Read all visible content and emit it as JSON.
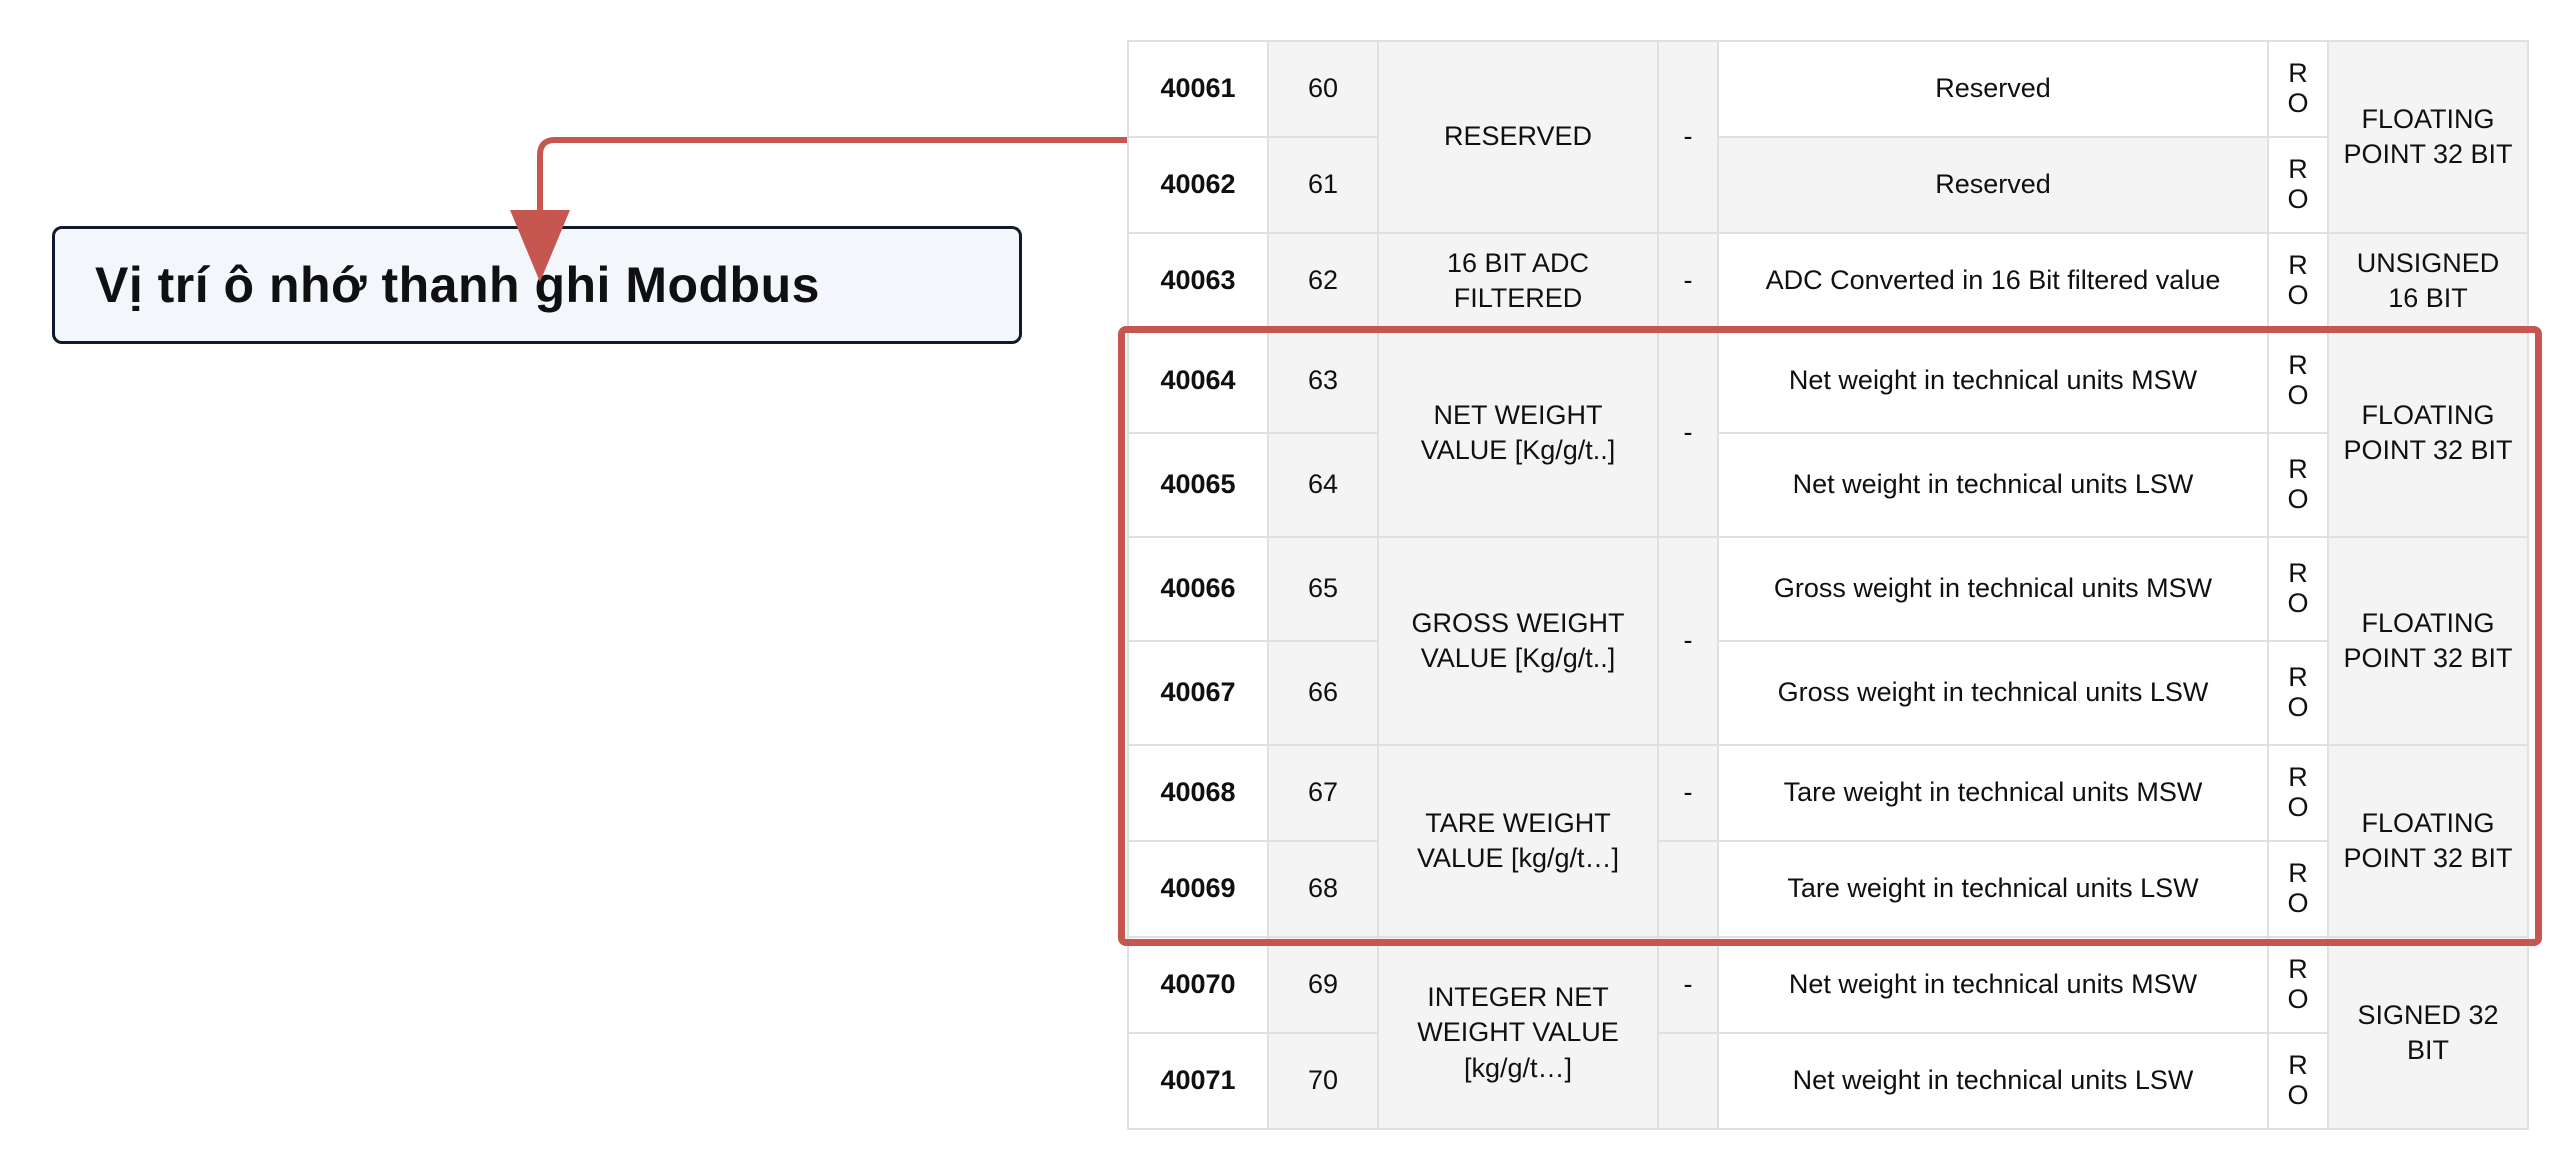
{
  "callout": {
    "label": "Vị trí ô nhớ thanh ghi Modbus"
  },
  "highlight": {
    "color": "#c65750"
  },
  "rows": [
    {
      "addr": "40061",
      "idx": "60",
      "name": "RESERVED",
      "dash": "-",
      "desc": "Reserved",
      "rw1": "R",
      "rw2": "O",
      "type": "FLOATING POINT 32 BIT",
      "alt": false
    },
    {
      "addr": "40062",
      "idx": "61",
      "desc": "Reserved",
      "rw1": "R",
      "rw2": "O",
      "alt": true
    },
    {
      "addr": "40063",
      "idx": "62",
      "name": "16 BIT ADC FILTERED",
      "dash": "-",
      "desc": "ADC Converted in 16 Bit filtered value",
      "rw1": "R",
      "rw2": "O",
      "type": "UNSIGNED 16 BIT",
      "alt": false
    },
    {
      "addr": "40064",
      "idx": "63",
      "name": "NET WEIGHT VALUE [Kg/g/t..]",
      "dash": "-",
      "desc": "Net weight in technical units MSW",
      "rw1": "R",
      "rw2": "O",
      "type": "FLOATING POINT 32 BIT",
      "alt": false
    },
    {
      "addr": "40065",
      "idx": "64",
      "desc": "Net weight in technical units LSW",
      "rw1": "R",
      "rw2": "O",
      "alt": false
    },
    {
      "addr": "40066",
      "idx": "65",
      "name": "GROSS WEIGHT VALUE [Kg/g/t..]",
      "dash": "-",
      "desc": "Gross weight in technical units MSW",
      "rw1": "R",
      "rw2": "O",
      "type": "FLOATING POINT 32 BIT",
      "alt": false
    },
    {
      "addr": "40067",
      "idx": "66",
      "desc": "Gross weight in technical units LSW",
      "rw1": "R",
      "rw2": "O",
      "alt": false
    },
    {
      "addr": "40068",
      "idx": "67",
      "name": "TARE WEIGHT VALUE [kg/g/t…]",
      "dash": "-",
      "desc": "Tare weight in technical units MSW",
      "rw1": "R",
      "rw2": "O",
      "type": "FLOATING POINT 32 BIT",
      "alt": false
    },
    {
      "addr": "40069",
      "idx": "68",
      "desc": "Tare weight in technical units LSW",
      "rw1": "R",
      "rw2": "O",
      "alt": false
    },
    {
      "addr": "40070",
      "idx": "69",
      "name": "INTEGER NET WEIGHT VALUE [kg/g/t…]",
      "dash": "-",
      "desc": "Net weight in technical units MSW",
      "rw1": "R",
      "rw2": "O",
      "type": "SIGNED 32 BIT",
      "alt": false
    },
    {
      "addr": "40071",
      "idx": "70",
      "desc": "Net weight in technical units LSW",
      "rw1": "R",
      "rw2": "O",
      "alt": false
    }
  ]
}
